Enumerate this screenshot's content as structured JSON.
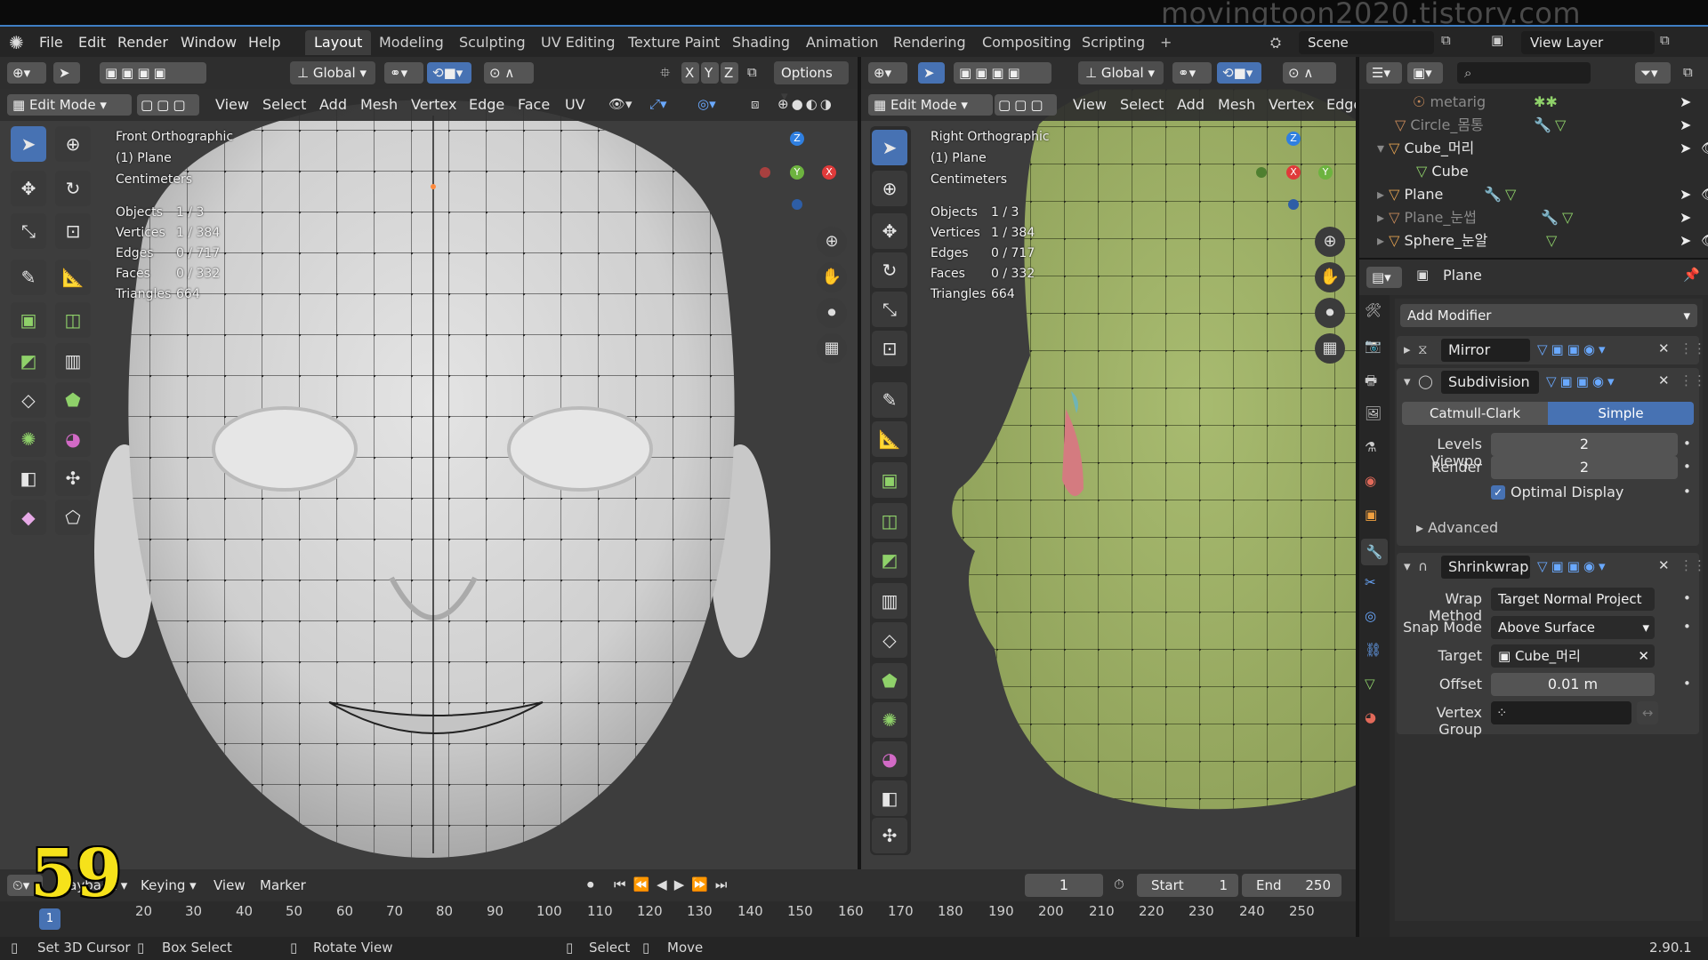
{
  "watermark": "movingtoon2020.tistory.com",
  "menu": [
    "File",
    "Edit",
    "Render",
    "Window",
    "Help"
  ],
  "workspaces": [
    "Layout",
    "Modeling",
    "Sculpting",
    "UV Editing",
    "Texture Paint",
    "Shading",
    "Animation",
    "Rendering",
    "Compositing",
    "Scripting",
    "+"
  ],
  "scene": "Scene",
  "view_layer": "View Layer",
  "left_view": {
    "transform": "Global",
    "options": "Options",
    "axes": [
      "X",
      "Y",
      "Z"
    ],
    "mode": "Edit Mode",
    "menus": [
      "View",
      "Select",
      "Add",
      "Mesh",
      "Vertex",
      "Edge",
      "Face",
      "UV"
    ],
    "info": [
      "Front Orthographic",
      "(1) Plane",
      "Centimeters"
    ],
    "stats": [
      {
        "k": "Objects",
        "v": "1 / 3"
      },
      {
        "k": "Vertices",
        "v": "1 / 384"
      },
      {
        "k": "Edges",
        "v": "0 / 717"
      },
      {
        "k": "Faces",
        "v": "0 / 332"
      },
      {
        "k": "Triangles",
        "v": "664"
      }
    ],
    "gizmo": {
      "z": "Z",
      "y": "Y",
      "x": "X"
    }
  },
  "right_view": {
    "transform": "Global",
    "mode": "Edit Mode",
    "menus": [
      "View",
      "Select",
      "Add",
      "Mesh",
      "Vertex",
      "Edge"
    ],
    "info": [
      "Right Orthographic",
      "(1) Plane",
      "Centimeters"
    ],
    "stats": [
      {
        "k": "Objects",
        "v": "1 / 3"
      },
      {
        "k": "Vertices",
        "v": "1 / 384"
      },
      {
        "k": "Edges",
        "v": "0 / 717"
      },
      {
        "k": "Faces",
        "v": "0 / 332"
      },
      {
        "k": "Triangles",
        "v": "664"
      }
    ],
    "gizmo": {
      "z": "Z",
      "y": "Y",
      "x": "X"
    }
  },
  "outliner": [
    "metarig",
    "Circle_몸통",
    "Cube_머리",
    "Cube",
    "Plane",
    "Plane_눈썹",
    "Sphere_눈알"
  ],
  "properties": {
    "object": "Plane",
    "add_modifier": "Add Modifier",
    "mirror": "Mirror",
    "subdivision": "Subdivision",
    "catmull": "Catmull-Clark",
    "simple": "Simple",
    "levels_label": "Levels Viewpo",
    "levels": "2",
    "render_label": "Render",
    "render": "2",
    "optimal": "Optimal Display",
    "advanced": "Advanced",
    "shrinkwrap": "Shrinkwrap",
    "wrap_label": "Wrap Method",
    "wrap": "Target Normal Project",
    "snap_label": "Snap Mode",
    "snap": "Above Surface",
    "target_label": "Target",
    "target": "Cube_머리",
    "offset_label": "Offset",
    "offset": "0.01 m",
    "vgroup_label": "Vertex Group"
  },
  "timeline": {
    "playback": "Playback",
    "keying": "Keying",
    "view": "View",
    "marker": "Marker",
    "frame": "1",
    "start_label": "Start",
    "start": "1",
    "end_label": "End",
    "end": "250",
    "ticks": [
      "20",
      "30",
      "40",
      "50",
      "60",
      "70",
      "80",
      "90",
      "100",
      "110",
      "120",
      "130",
      "140",
      "150",
      "160",
      "170",
      "180",
      "190",
      "200",
      "210",
      "220",
      "230",
      "240",
      "250"
    ],
    "overlay_number": "59"
  },
  "status": {
    "cursor": "Set 3D Cursor",
    "box": "Box Select",
    "rotate": "Rotate View",
    "select": "Select",
    "move": "Move",
    "version": "2.90.1"
  }
}
